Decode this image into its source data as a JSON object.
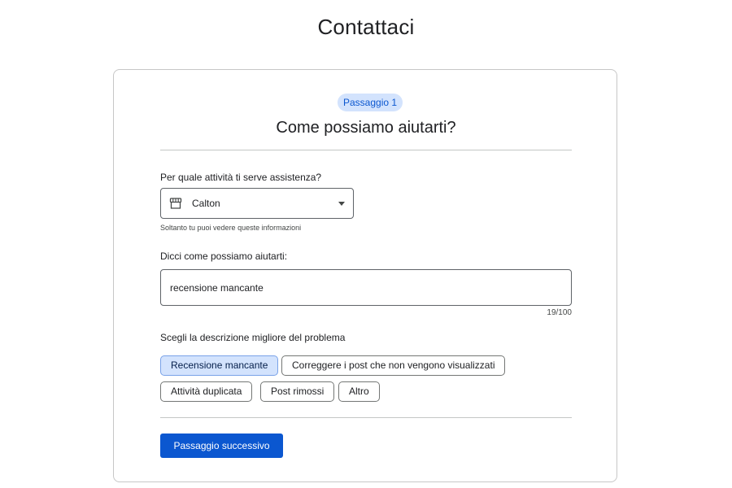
{
  "page": {
    "title": "Contattaci"
  },
  "form": {
    "step_badge": "Passaggio 1",
    "heading": "Come possiamo aiutarti?",
    "business_question": "Per quale attività ti serve assistenza?",
    "business_select": {
      "icon": "store-icon",
      "value": "Calton"
    },
    "business_helper": "Soltanto tu puoi vedere queste informazioni",
    "help_question": "Dicci come possiamo aiutarti:",
    "help_input": {
      "value": "recensione mancante",
      "counter": "19/100"
    },
    "problem_question": "Scegli la descrizione migliore del problema",
    "problem_options": [
      {
        "label": "Recensione mancante",
        "selected": true
      },
      {
        "label": "Correggere i post che non vengono visualizzati",
        "selected": false
      },
      {
        "label": "Attività duplicata",
        "selected": false
      },
      {
        "label": "Post rimossi",
        "selected": false
      },
      {
        "label": "Altro",
        "selected": false
      }
    ],
    "next_button": "Passaggio successivo"
  },
  "colors": {
    "primary": "#0b57d0",
    "chip_selected_bg": "#d3e3fd",
    "badge_bg": "#d3e3fd"
  }
}
